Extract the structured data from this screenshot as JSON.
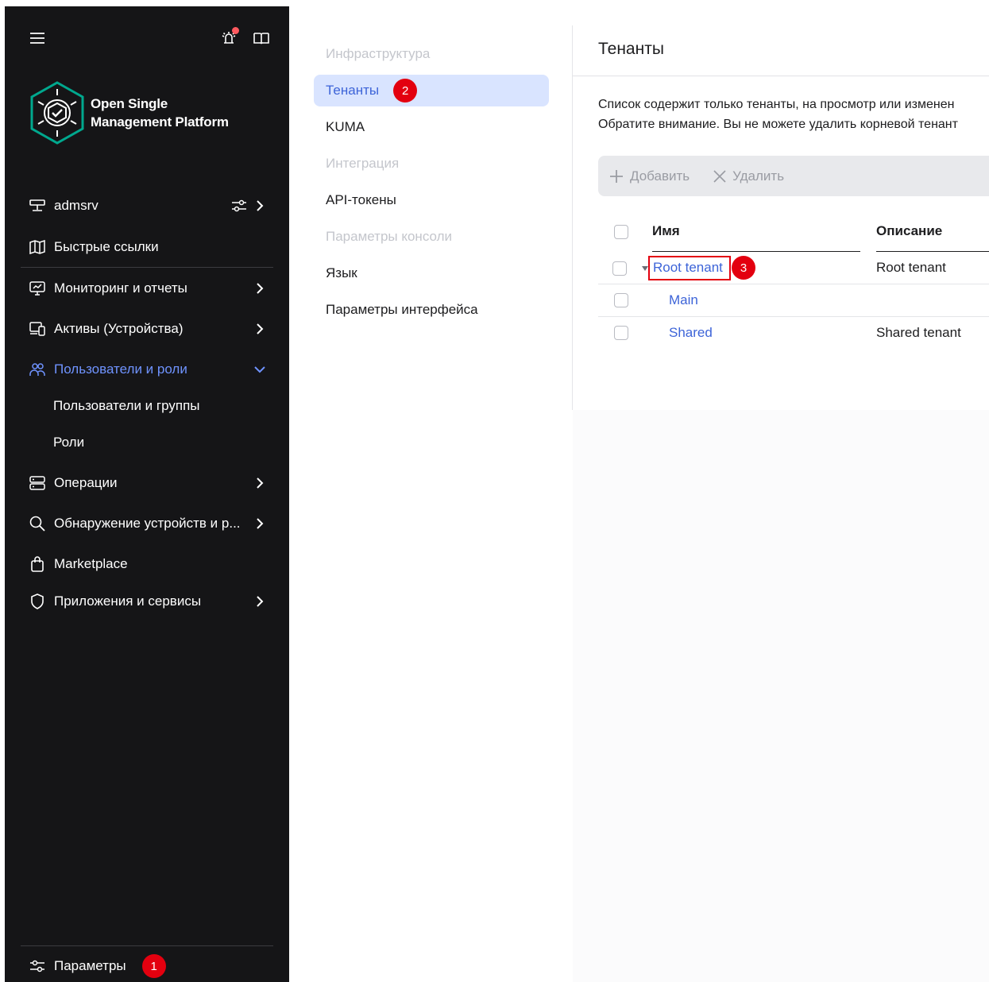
{
  "sidebar": {
    "logo_text": "Open Single Management Platform",
    "items": [
      {
        "label": "admsrv"
      },
      {
        "label": "Быстрые ссылки"
      },
      {
        "label": "Мониторинг и отчеты"
      },
      {
        "label": "Активы (Устройства)"
      },
      {
        "label": "Пользователи и роли"
      },
      {
        "label": "Операции"
      },
      {
        "label": "Обнаружение устройств и р..."
      },
      {
        "label": "Marketplace"
      },
      {
        "label": "Приложения и сервисы"
      }
    ],
    "subitems": [
      {
        "label": "Пользователи и группы"
      },
      {
        "label": "Роли"
      }
    ],
    "settings_label": "Параметры",
    "settings_badge": "1"
  },
  "settings_menu": {
    "items": [
      {
        "label": "Инфраструктура"
      },
      {
        "label": "Тенанты"
      },
      {
        "label": "KUMA"
      },
      {
        "label": "Интеграция"
      },
      {
        "label": "API-токены"
      },
      {
        "label": "Параметры консоли"
      },
      {
        "label": "Язык"
      },
      {
        "label": "Параметры интерфейса"
      }
    ],
    "selected_badge": "2"
  },
  "main": {
    "title": "Тенанты",
    "info_line1": "Список содержит только тенанты, на просмотр или изменен",
    "info_line2": "Обратите внимание. Вы не можете удалить корневой тенант",
    "toolbar": {
      "add_label": "Добавить",
      "delete_label": "Удалить"
    },
    "table": {
      "columns": [
        "Имя",
        "Описание"
      ],
      "rows": [
        {
          "name": "Root tenant",
          "description": "Root tenant"
        },
        {
          "name": "Main",
          "description": ""
        },
        {
          "name": "Shared",
          "description": "Shared tenant"
        }
      ],
      "row_badge": "3"
    }
  },
  "colors": {
    "sidebar_bg": "#151517",
    "accent": "#3d64d8",
    "sidebar_active": "#6f93ff",
    "badge": "#e3000f",
    "selected_bg": "#d9e4ff"
  }
}
